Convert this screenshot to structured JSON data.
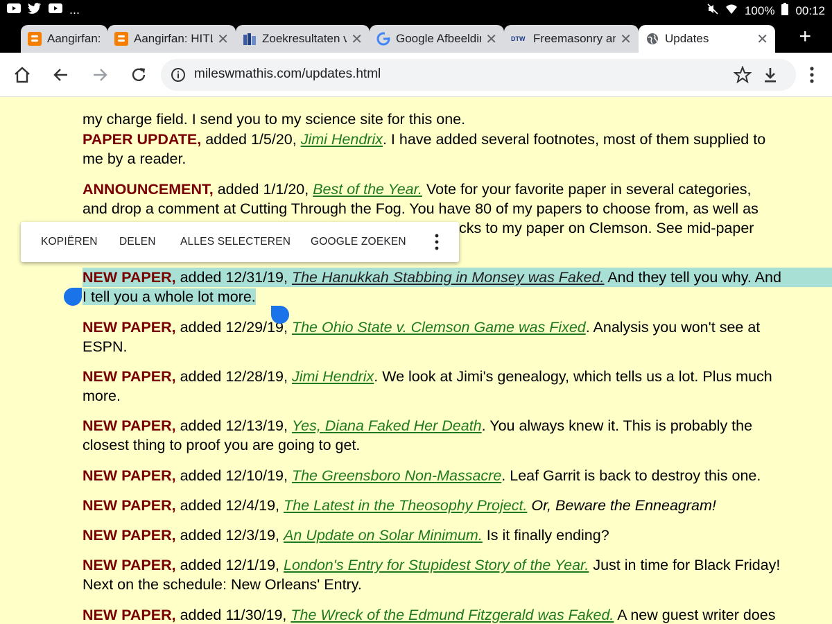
{
  "status_bar": {
    "battery": "100%",
    "time": "00:12"
  },
  "tabs": [
    {
      "title": "Aangirfan:",
      "favicon": "blogger-icon",
      "active": false
    },
    {
      "title": "Aangirfan: HITLER",
      "favicon": "blogger-icon",
      "active": false
    },
    {
      "title": "Zoekresultaten v",
      "favicon": "books-icon",
      "active": false
    },
    {
      "title": "Google Afbeeldin",
      "favicon": "google-icon",
      "active": false
    },
    {
      "title": "Freemasonry and",
      "favicon": "dtw-icon",
      "favicon_text": "DTW",
      "active": false
    },
    {
      "title": "Updates",
      "favicon": "globe-icon",
      "active": true
    }
  ],
  "toolbar": {
    "url": "mileswmathis.com/updates.html"
  },
  "context_menu": {
    "items": [
      "KOPIËREN",
      "DELEN",
      "ALLES SELECTEREN",
      "GOOGLE ZOEKEN"
    ]
  },
  "content": {
    "partial_top": "my charge field. I send you to my science site for this one.",
    "entries": [
      {
        "tag": "PAPER UPDATE,",
        "added": " added 1/5/20, ",
        "link": "Jimi Hendrix",
        "rest1": ". I have added several footnotes, most of them supplied to",
        "rest2": "me by a reader."
      },
      {
        "tag": "ANNOUNCEMENT,",
        "added": " added 1/1/20, ",
        "link": "Best of the Year.",
        "rest1": " Vote for your favorite paper in several categories,",
        "rest2": "and drop a comment at Cutting Through the Fog. You have 80 of my papers to choose from, as well as",
        "rest3": "erbacks to my paper on Clemson. See mid-paper"
      },
      {
        "tag": "NEW PAPER,",
        "added": " added 12/31/19, ",
        "link": "The Hanukkah Stabbing in Monsey was Faked.",
        "rest1": " And they tell you why. And",
        "rest2": "I tell you a whole lot more."
      },
      {
        "tag": "NEW PAPER,",
        "added": " added 12/29/19, ",
        "link": "The Ohio State v. Clemson Game was Fixed",
        "rest1": ". Analysis you won't see at",
        "rest2": "ESPN."
      },
      {
        "tag": "NEW PAPER,",
        "added": " added 12/28/19, ",
        "link": "Jimi Hendrix",
        "rest1": ". We look at Jimi's genealogy, which tells us a lot. Plus much",
        "rest2": "more."
      },
      {
        "tag": "NEW PAPER,",
        "added": " added 12/13/19, ",
        "link": "Yes, Diana Faked Her Death",
        "rest1": ". You always knew it. This is probably the",
        "rest2": "closest thing to proof you are going to get."
      },
      {
        "tag": "NEW PAPER,",
        "added": " added 12/10/19, ",
        "link": "The Greensboro Non-Massacre",
        "rest1": ". Leaf Garrit is back to destroy this one."
      },
      {
        "tag": "NEW PAPER,",
        "added": " added 12/4/19, ",
        "link": "The Latest in the Theosophy Project.",
        "rest1_em": " Or, Beware the Enneagram!"
      },
      {
        "tag": "NEW PAPER,",
        "added": " added 12/3/19, ",
        "link": "An Update on Solar Minimum.",
        "rest1": " Is it finally ending?"
      },
      {
        "tag": "NEW PAPER,",
        "added": " added 12/1/19, ",
        "link": "London's Entry for Stupidest Story of the Year.",
        "rest1": " Just in time for Black Friday!",
        "rest2": "Next on the schedule: New Orleans' Entry."
      },
      {
        "tag": "NEW PAPER,",
        "added": " added 11/30/19, ",
        "link": "The Wreck of the Edmund Fitzgerald was Faked.",
        "rest1": " A new guest writer does"
      }
    ]
  }
}
